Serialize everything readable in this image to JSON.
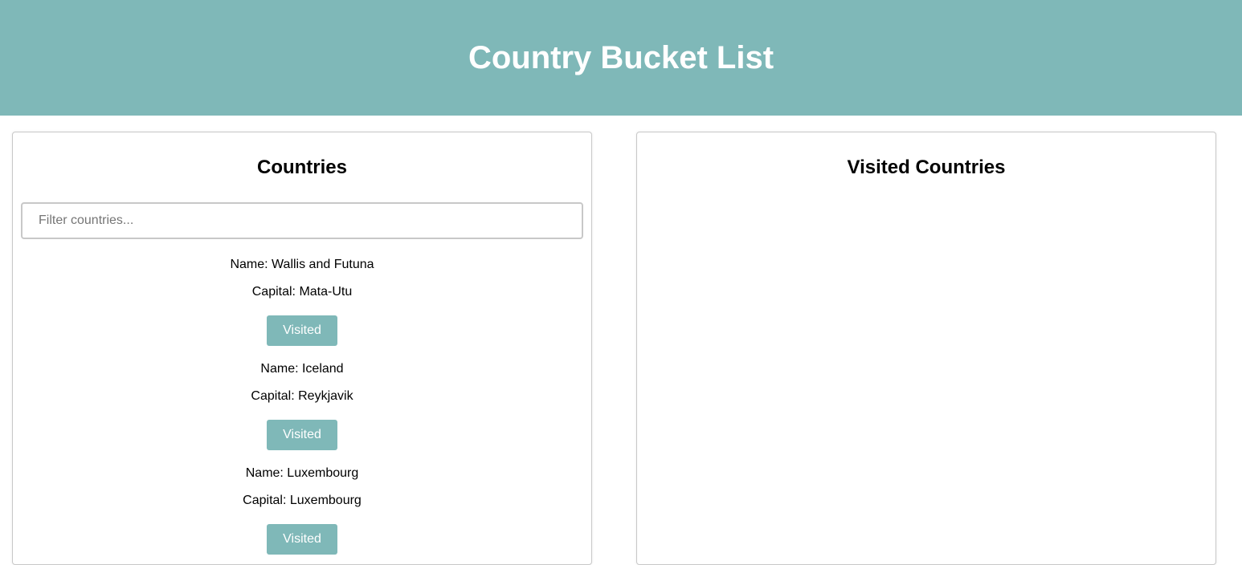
{
  "header": {
    "title": "Country Bucket List",
    "background_color": "#7fb8b8"
  },
  "countries_panel": {
    "heading": "Countries",
    "filter_placeholder": "Filter countries...",
    "filter_value": "",
    "items": [
      {
        "name": "Name: Wallis and Futuna",
        "capital": "Capital: Mata-Utu",
        "button_label": "Visited"
      },
      {
        "name": "Name: Iceland",
        "capital": "Capital: Reykjavik",
        "button_label": "Visited"
      },
      {
        "name": "Name: Luxembourg",
        "capital": "Capital: Luxembourg",
        "button_label": "Visited"
      }
    ]
  },
  "visited_panel": {
    "heading": "Visited Countries"
  },
  "colors": {
    "accent": "#7fb8b8",
    "button_text": "#ffffff",
    "panel_border": "#c8c8c8"
  }
}
